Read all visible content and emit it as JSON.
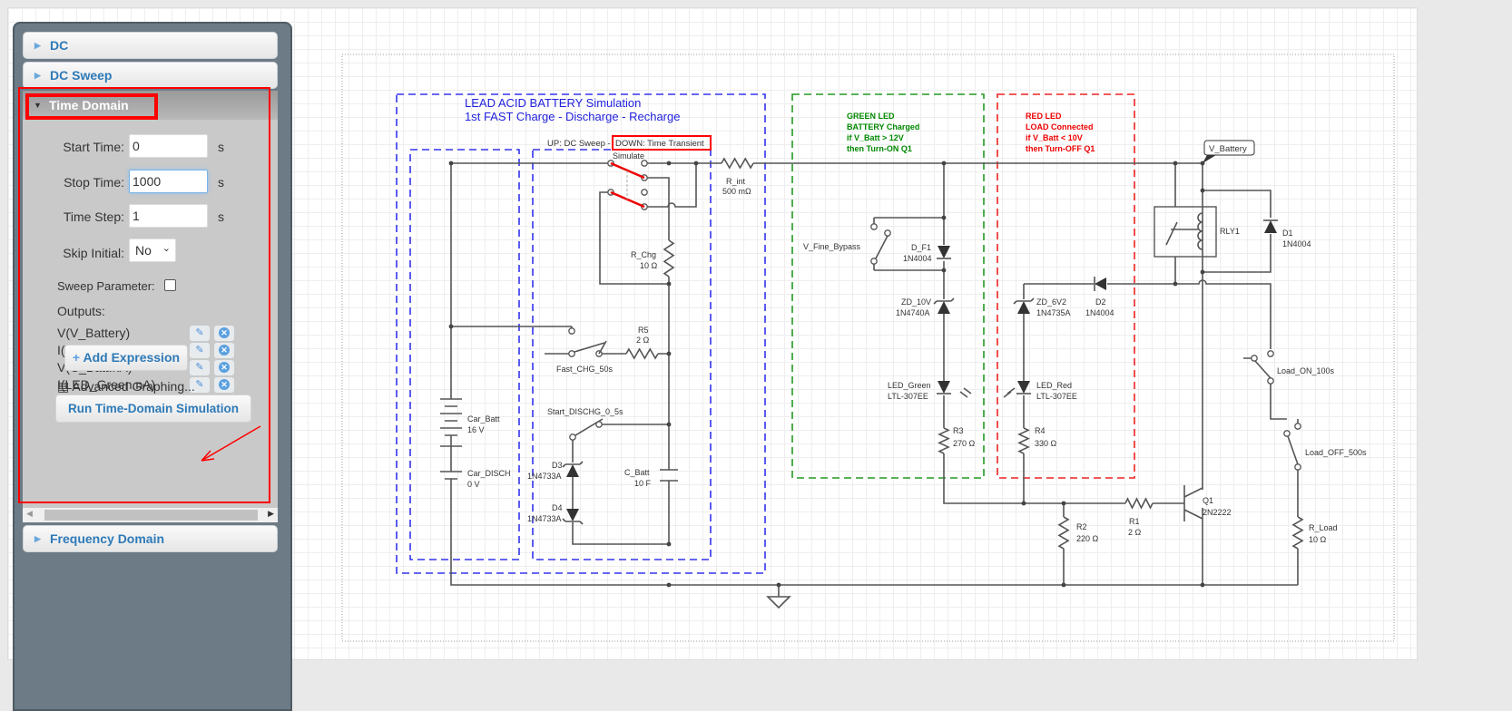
{
  "panel": {
    "sections": {
      "dc": "DC",
      "dc_sweep": "DC Sweep",
      "time_domain": "Time Domain",
      "frequency_domain": "Frequency Domain"
    },
    "time_domain": {
      "start_time_label": "Start Time:",
      "start_time": "0",
      "start_unit": "s",
      "stop_time_label": "Stop Time:",
      "stop_time": "1000",
      "stop_unit": "s",
      "time_step_label": "Time Step:",
      "time_step": "1",
      "step_unit": "s",
      "skip_initial_label": "Skip Initial:",
      "skip_initial": "No",
      "sweep_parameter_label": "Sweep Parameter:",
      "sweep_parameter_checked": false,
      "outputs_label": "Outputs:",
      "outputs": [
        "V(V_Battery)",
        "I(Q1.nB)",
        "V(C_Batt.nA)",
        "I(LED_Green.nA)",
        "I(LED_Red.nA)"
      ],
      "add_expression": "Add Expression",
      "advanced_graphing": "Advanced Graphing...",
      "run_button": "Run Time-Domain Simulation"
    }
  },
  "schematic": {
    "title1": "LEAD ACID BATTERY Simulation",
    "title2": "1st FAST Charge - Discharge - Recharge",
    "mode_note_up": "UP: DC Sweep - ",
    "mode_note_down": "DOWN: Time Transient",
    "simulate": "Simulate",
    "r_int": "R_int",
    "r_int_val": "500 mΩ",
    "r_chg": "R_Chg",
    "r_chg_val": "10 Ω",
    "r5": "R5",
    "r5_val": "2 Ω",
    "fast_chg": "Fast_CHG_50s",
    "start_dischg": "Start_DISCHG_0_5s",
    "car_batt": "Car_Batt",
    "car_batt_val": "16 V",
    "car_disch": "Car_DISCH",
    "car_disch_val": "0 V",
    "d3": "D3",
    "d3_val": "1N4733A",
    "d4": "D4",
    "d4_val": "1N4733A",
    "c_batt": "C_Batt",
    "c_batt_val": "10 F",
    "green_note": [
      "GREEN LED",
      "BATTERY Charged",
      "if V_Batt > 12V",
      "then Turn-ON Q1"
    ],
    "red_note": [
      "RED LED",
      "LOAD Connected",
      "if V_Batt < 10V",
      "then Turn-OFF Q1"
    ],
    "v_fine_bypass": "V_Fine_Bypass",
    "d_f1": "D_F1",
    "d_f1_val": "1N4004",
    "zd_10v": "ZD_10V",
    "zd_10v_val": "1N4740A",
    "led_green": "LED_Green",
    "led_green_val": "LTL-307EE",
    "r3": "R3",
    "r3_val": "270 Ω",
    "zd_6v2": "ZD_6V2",
    "zd_6v2_val": "1N4735A",
    "led_red": "LED_Red",
    "led_red_val": "LTL-307EE",
    "r4": "R4",
    "r4_val": "330 Ω",
    "d2": "D2",
    "d2_val": "1N4004",
    "r2": "R2",
    "r2_val": "220 Ω",
    "r1": "R1",
    "r1_val": "2 Ω",
    "q1": "Q1",
    "q1_val": "2N2222",
    "rly1": "RLY1",
    "d1": "D1",
    "d1_val": "1N4004",
    "load_on": "Load_ON_100s",
    "load_off": "Load_OFF_500s",
    "r_load": "R_Load",
    "r_load_val": "10 Ω",
    "v_battery": "V_Battery"
  },
  "colors": {
    "accent": "#2e7ab8",
    "annotation": "#ff0000",
    "blue_group": "#3333ee",
    "green_group": "#229922",
    "red_group": "#ee2222",
    "wire": "#555555"
  }
}
